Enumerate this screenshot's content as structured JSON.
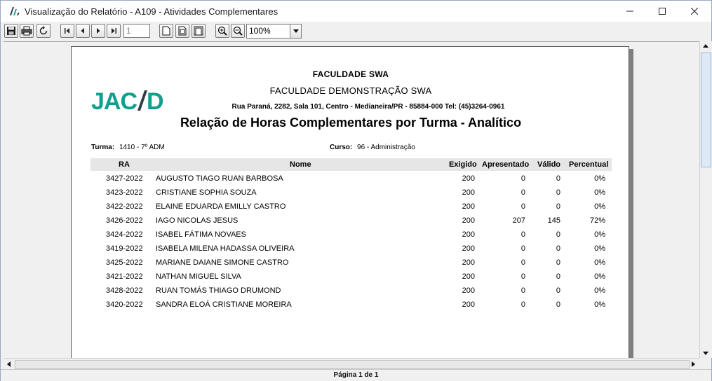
{
  "window": {
    "title": "Visualização do Relatório - A109 - Atividades Complementares",
    "minimize_icon": "minimize-icon",
    "maximize_icon": "maximize-icon",
    "close_icon": "close-icon"
  },
  "toolbar": {
    "page_input_value": "1",
    "zoom_value": "100%"
  },
  "report": {
    "institution": "FACULDADE SWA",
    "subtitle": "FACULDADE DEMONSTRAÇÃO SWA",
    "address": "Rua Paraná, 2282, Sala 101, Centro - Medianeira/PR - 85884-000 Tel: (45)3264-0961",
    "heading": "Relação de Horas Complementares por Turma - Analítico",
    "logo_text": "JACAD",
    "turma_label": "Turma:",
    "turma_value": "1410 - 7º ADM",
    "curso_label": "Curso:",
    "curso_value": "96 - Administração",
    "columns": [
      "RA",
      "Nome",
      "Exigido",
      "Apresentado",
      "Válido",
      "Percentual"
    ],
    "rows": [
      {
        "ra": "3427-2022",
        "nome": "AUGUSTO TIAGO RUAN BARBOSA",
        "exigido": "200",
        "apresentado": "0",
        "valido": "0",
        "percentual": "0%"
      },
      {
        "ra": "3423-2022",
        "nome": "CRISTIANE SOPHIA SOUZA",
        "exigido": "200",
        "apresentado": "0",
        "valido": "0",
        "percentual": "0%"
      },
      {
        "ra": "3422-2022",
        "nome": "ELAINE EDUARDA EMILLY CASTRO",
        "exigido": "200",
        "apresentado": "0",
        "valido": "0",
        "percentual": "0%"
      },
      {
        "ra": "3426-2022",
        "nome": "IAGO NICOLAS JESUS",
        "exigido": "200",
        "apresentado": "207",
        "valido": "145",
        "percentual": "72%"
      },
      {
        "ra": "3424-2022",
        "nome": "ISABEL FÁTIMA NOVAES",
        "exigido": "200",
        "apresentado": "0",
        "valido": "0",
        "percentual": "0%"
      },
      {
        "ra": "3419-2022",
        "nome": "ISABELA MILENA HADASSA OLIVEIRA",
        "exigido": "200",
        "apresentado": "0",
        "valido": "0",
        "percentual": "0%"
      },
      {
        "ra": "3425-2022",
        "nome": "MARIANE DAIANE SIMONE CASTRO",
        "exigido": "200",
        "apresentado": "0",
        "valido": "0",
        "percentual": "0%"
      },
      {
        "ra": "3421-2022",
        "nome": "NATHAN MIGUEL SILVA",
        "exigido": "200",
        "apresentado": "0",
        "valido": "0",
        "percentual": "0%"
      },
      {
        "ra": "3428-2022",
        "nome": "RUAN TOMÁS THIAGO DRUMOND",
        "exigido": "200",
        "apresentado": "0",
        "valido": "0",
        "percentual": "0%"
      },
      {
        "ra": "3420-2022",
        "nome": "SANDRA ELOÁ CRISTIANE MOREIRA",
        "exigido": "200",
        "apresentado": "0",
        "valido": "0",
        "percentual": "0%"
      }
    ]
  },
  "status": {
    "page_info": "Página 1 de 1"
  },
  "colors": {
    "logo_teal": "#0fa08e",
    "logo_dark": "#2d3a4a"
  }
}
